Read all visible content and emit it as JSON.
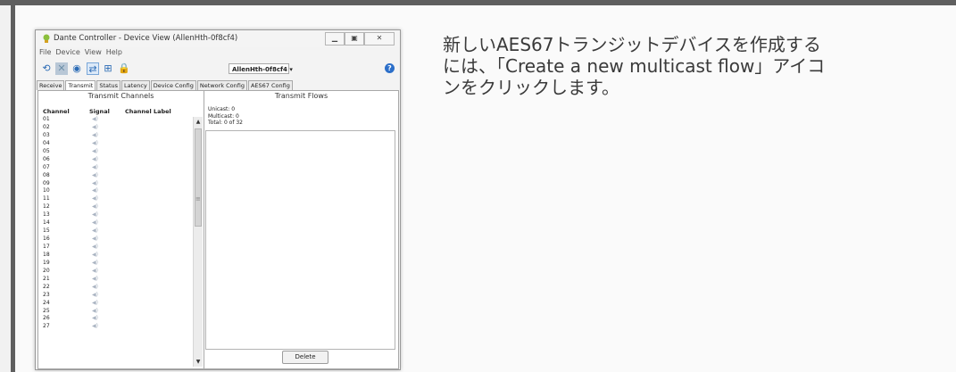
{
  "window": {
    "title": "Dante Controller - Device View (AllenHth-0f8cf4)",
    "controls": [
      "▁",
      "▣",
      "✕"
    ],
    "menu": [
      "File",
      "Device",
      "View",
      "Help"
    ],
    "device_select": "AllenHth-0f8cf4 ▾",
    "help_label": "?",
    "tabs": [
      "Receive",
      "Transmit",
      "Status",
      "Latency",
      "Device Config",
      "Network Config",
      "AES67 Config"
    ],
    "active_tab": "Transmit"
  },
  "transmit_channels": {
    "title": "Transmit Channels",
    "headers": [
      "Channel",
      "Signal",
      "Channel Label"
    ],
    "rows": [
      "01",
      "02",
      "03",
      "04",
      "05",
      "06",
      "07",
      "08",
      "09",
      "10",
      "11",
      "12",
      "13",
      "14",
      "15",
      "16",
      "17",
      "18",
      "19",
      "20",
      "21",
      "22",
      "23",
      "24",
      "25",
      "26",
      "27"
    ]
  },
  "transmit_flows": {
    "title": "Transmit Flows",
    "unicast": "Unicast:   0",
    "multicast": "Multicast: 0",
    "total": "Total:      0 of 32",
    "delete_label": "Delete"
  },
  "instruction": {
    "line1": "新しいAES67トランジットデバイスを作成する",
    "line2": "には、「Create a new multicast flow」アイコ",
    "line3": "ンをクリックします。"
  }
}
